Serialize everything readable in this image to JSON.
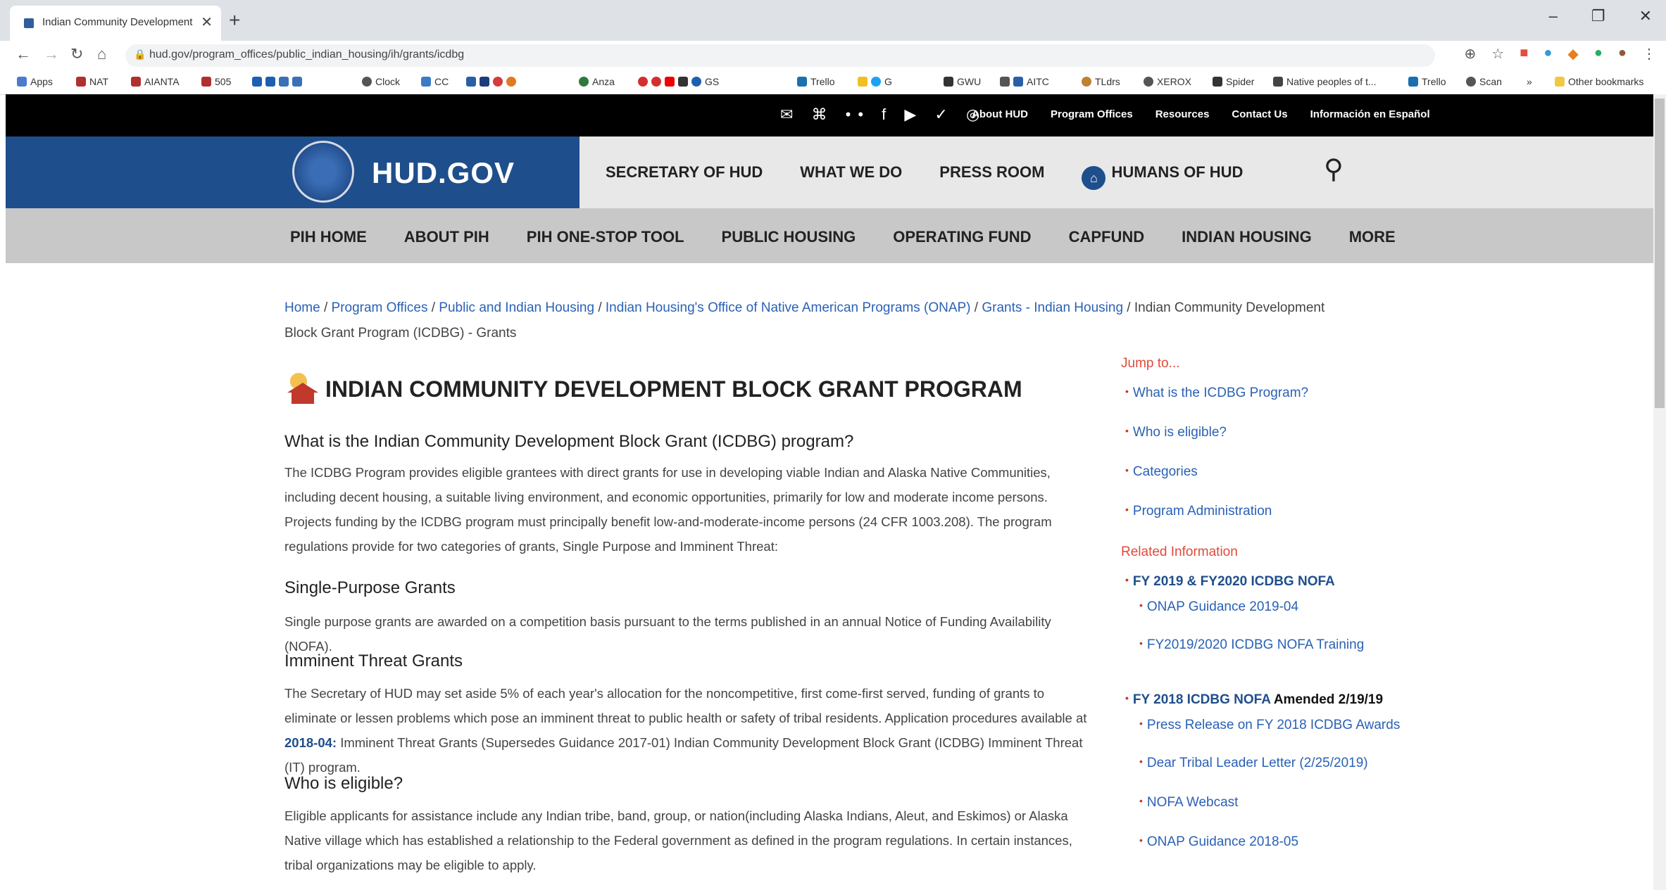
{
  "browser": {
    "tab_title": "Indian Community Development",
    "new_tab": "+",
    "url": "hud.gov/program_offices/public_indian_housing/ih/grants/icdbg",
    "bookmarks": [
      "Apps",
      "NAT",
      "AIANTA",
      "505",
      "Clock",
      "CC",
      "Anza",
      "GS",
      "Trello",
      "G",
      "GWU",
      "AITC",
      "TLdrs",
      "XEROX",
      "Spider",
      "Native peoples of t...",
      "Trello",
      "Scan",
      "»",
      "Other bookmarks"
    ]
  },
  "topbar": {
    "social": "✉ ⌘ •• f ▶ ✓ ◎",
    "links": [
      "About HUD",
      "Program Offices",
      "Resources",
      "Contact Us",
      "Información en Español"
    ]
  },
  "header": {
    "brand": "HUD.GOV",
    "nav": [
      "SECRETARY OF HUD",
      "WHAT WE DO",
      "PRESS ROOM",
      "HUMANS OF HUD"
    ]
  },
  "subnav": [
    "PIH HOME",
    "ABOUT PIH",
    "PIH ONE-STOP TOOL",
    "PUBLIC HOUSING",
    "OPERATING FUND",
    "CAPFUND",
    "INDIAN HOUSING",
    "MORE"
  ],
  "breadcrumb": {
    "links": [
      "Home",
      "Program Offices",
      "Public and Indian Housing",
      "Indian Housing's Office of Native American Programs (ONAP)",
      "Grants - Indian Housing"
    ],
    "current": "Indian Community Development Block Grant Program (ICDBG) - Grants"
  },
  "content": {
    "title": "INDIAN COMMUNITY DEVELOPMENT BLOCK GRANT PROGRAM",
    "h_what": "What is the Indian Community Development Block Grant (ICDBG) program?",
    "p_what": "The ICDBG Program provides eligible grantees with direct grants for use in developing viable Indian and Alaska Native Communities, including decent housing, a suitable living environment, and economic opportunities, primarily for low and moderate income persons.  Projects funding by the ICDBG program must principally benefit low-and-moderate-income persons (24 CFR 1003.208).  The program regulations provide for two categories of grants, Single Purpose and Imminent Threat:",
    "h_single": "Single-Purpose Grants",
    "p_single": "Single purpose grants are awarded on a competition basis pursuant to the terms published in an annual Notice of Funding Availability (NOFA).",
    "h_imminent": "Imminent Threat Grants",
    "p_imminent_pre": "The Secretary of HUD may set aside 5% of each year's allocation for the noncompetitive, first come-first served, funding of grants to eliminate or lessen problems which pose an imminent threat to public health or safety of tribal residents.  Application procedures available at ",
    "p_imminent_link": "2018-04:",
    "p_imminent_post": " Imminent Threat Grants (Supersedes Guidance 2017-01) Indian Community Development Block Grant (ICDBG) Imminent Threat (IT) program.",
    "h_eligible": "Who is eligible?",
    "p_eligible": "Eligible applicants for assistance include any Indian tribe, band, group, or nation(including Alaska Indians, Aleut, and Eskimos) or Alaska Native village which has established a relationship to the Federal government as defined in the program regulations. In certain instances, tribal organizations may be eligible to apply."
  },
  "sidebar": {
    "jump_heading": "Jump to...",
    "jump_links": [
      "What is the ICDBG Program?",
      "Who is eligible?",
      "Categories",
      "Program Administration"
    ],
    "related_heading": "Related Information",
    "nofa_2019": "FY 2019 & FY2020 ICDBG NOFA",
    "nofa_2019_links": [
      "ONAP Guidance 2019-04",
      "FY2019/2020 ICDBG NOFA Training"
    ],
    "nofa_2018": "FY 2018 ICDBG NOFA",
    "nofa_2018_amended": " Amended 2/19/19",
    "nofa_2018_links": [
      "Press Release on FY 2018 ICDBG Awards",
      "Dear Tribal Leader Letter (2/25/2019)",
      "NOFA Webcast",
      "ONAP Guidance 2018-05"
    ]
  }
}
